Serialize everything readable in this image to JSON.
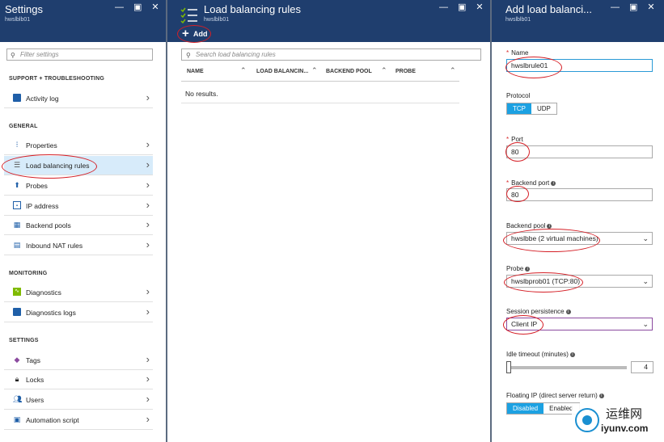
{
  "settings": {
    "title": "Settings",
    "subtitle": "hwslblb01",
    "filter_placeholder": "Filter settings",
    "sections": {
      "support": "SUPPORT + TROUBLESHOOTING",
      "general": "GENERAL",
      "monitoring": "MONITORING",
      "settings": "SETTINGS"
    },
    "items": {
      "activity_log": "Activity log",
      "properties": "Properties",
      "lb_rules": "Load balancing rules",
      "probes": "Probes",
      "ip_address": "IP address",
      "backend_pools": "Backend pools",
      "nat_rules": "Inbound NAT rules",
      "diagnostics": "Diagnostics",
      "diagnostics_logs": "Diagnostics logs",
      "tags": "Tags",
      "locks": "Locks",
      "users": "Users",
      "automation": "Automation script"
    },
    "icon_colors": {
      "activity": "#1f5fa8",
      "diagnostics": "#7fba00",
      "tags": "#8b4a9f",
      "selected_bg": "#d7ebfa"
    }
  },
  "rules": {
    "title": "Load balancing rules",
    "subtitle": "hwslblb01",
    "add_label": "Add",
    "search_placeholder": "Search load balancing rules",
    "columns": [
      "NAME",
      "LOAD BALANCIN...",
      "BACKEND POOL",
      "PROBE"
    ],
    "empty_text": "No results."
  },
  "add_rule": {
    "title": "Add load balanci...",
    "subtitle": "hwslblb01",
    "name_label": "Name",
    "name_value": "hwslbrule01",
    "protocol_label": "Protocol",
    "protocol_options": [
      "TCP",
      "UDP"
    ],
    "protocol_selected": "TCP",
    "port_label": "Port",
    "port_value": "80",
    "backend_port_label": "Backend port",
    "backend_port_value": "80",
    "backend_pool_label": "Backend pool",
    "backend_pool_value": "hwslbbe (2 virtual machines)",
    "probe_label": "Probe",
    "probe_value": "hwslbprob01 (TCP:80)",
    "session_label": "Session persistence",
    "session_value": "Client IP",
    "idle_label": "Idle timeout (minutes)",
    "idle_value": "4",
    "idle_level_fraction": 0.0,
    "floating_label": "Floating IP (direct server return)",
    "floating_options": [
      "Disabled",
      "Enabled"
    ],
    "floating_selected": "Disabled"
  },
  "theme": {
    "header_bg": "#1f3e6e",
    "accent": "#1ca1e2",
    "annotation_red": "#d51f26"
  },
  "watermark": {
    "cn": "运维网",
    "en": "iyunv.com"
  }
}
